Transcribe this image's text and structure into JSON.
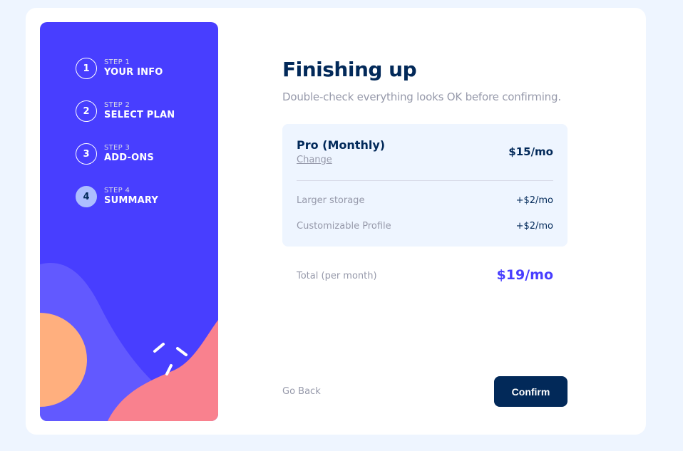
{
  "steps": [
    {
      "small": "STEP 1",
      "title": "YOUR INFO",
      "num": "1",
      "active": false
    },
    {
      "small": "STEP 2",
      "title": "SELECT PLAN",
      "num": "2",
      "active": false
    },
    {
      "small": "STEP 3",
      "title": "ADD-ONS",
      "num": "3",
      "active": false
    },
    {
      "small": "STEP 4",
      "title": "SUMMARY",
      "num": "4",
      "active": true
    }
  ],
  "main": {
    "heading": "Finishing up",
    "subheading": "Double-check everything looks OK before confirming."
  },
  "summary": {
    "plan_name": "Pro (Monthly)",
    "change_label": "Change",
    "plan_price": "$15/mo",
    "addons": [
      {
        "name": "Larger storage",
        "price": "+$2/mo"
      },
      {
        "name": "Customizable Profile",
        "price": "+$2/mo"
      }
    ]
  },
  "total": {
    "label": "Total (per month)",
    "price": "$19/mo"
  },
  "actions": {
    "back_label": "Go Back",
    "confirm_label": "Confirm"
  },
  "colors": {
    "sidebar": "#483eff",
    "accent": "#483eff",
    "primary_dark": "#022959",
    "muted": "#9699aa",
    "box_bg": "#eef5ff"
  }
}
